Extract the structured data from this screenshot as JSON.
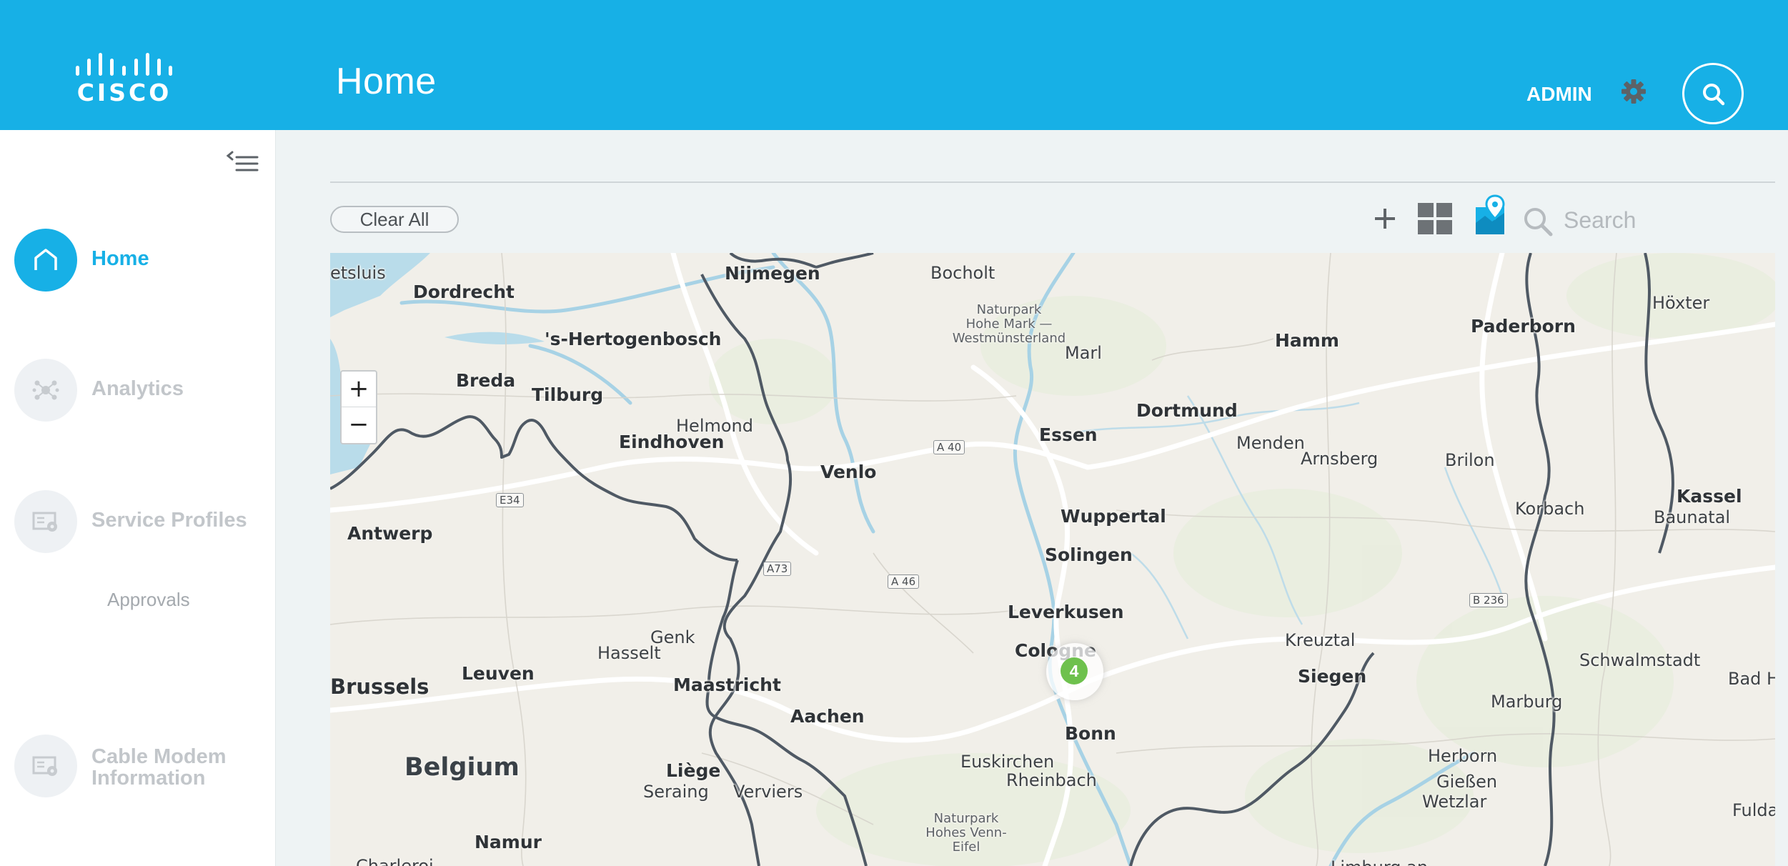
{
  "header": {
    "logo_text": "CISCO",
    "title": "Home",
    "user": "ADMIN",
    "settings_icon": "gear-icon",
    "search_icon": "search-icon",
    "color": "#17b0e6"
  },
  "sidebar": {
    "collapse_icon": "collapse-menu-icon",
    "items": [
      {
        "label": "Home",
        "icon": "home-icon",
        "active": true
      },
      {
        "label": "Analytics",
        "icon": "analytics-icon",
        "active": false
      },
      {
        "label": "Service Profiles",
        "icon": "service-profiles-icon",
        "active": false
      },
      {
        "label": "Cable Modem Information",
        "icon": "cable-modem-icon",
        "active": false
      }
    ],
    "sub_items": [
      {
        "label": "Approvals"
      }
    ]
  },
  "toolbar": {
    "clear_all": "Clear All",
    "add_icon": "plus-icon",
    "grid_icon": "grid-view-icon",
    "map_icon": "map-view-icon",
    "search_placeholder": "Search"
  },
  "map": {
    "zoom_in": "+",
    "zoom_out": "−",
    "cluster_count": "4",
    "cluster_color": "#6ec14d",
    "labels": {
      "etsluis": "etsluis",
      "nijmegen": "Nijmegen",
      "bocholt": "Bocholt",
      "hoxter": "Höxter",
      "dordrecht": "Dordrecht",
      "park1": "Naturpark\nHohe Mark —\nWestmünsterland",
      "hamm": "Hamm",
      "paderborn": "Paderborn",
      "hertogenbosch": "'s-Hertogenbosch",
      "marl": "Marl",
      "breda": "Breda",
      "tilburg": "Tilburg",
      "dortmund": "Dortmund",
      "helmond": "Helmond",
      "eindhoven": "Eindhoven",
      "essen": "Essen",
      "menden": "Menden",
      "arnsberg": "Arnsberg",
      "brilon": "Brilon",
      "venlo": "Venlo",
      "kassel": "Kassel",
      "baunatal": "Baunatal",
      "korbach": "Korbach",
      "wuppertal": "Wuppertal",
      "antwerp": "Antwerp",
      "solingen": "Solingen",
      "leverkusen": "Leverkusen",
      "genk": "Genk",
      "kreuztal": "Kreuztal",
      "hasselt": "Hasselt",
      "cologne": "Cologne",
      "schwalmstadt": "Schwalmstadt",
      "leuven": "Leuven",
      "siegen": "Siegen",
      "badhersfeld": "Bad Her",
      "brussels": "Brussels",
      "maastricht": "Maastricht",
      "marburg": "Marburg",
      "aachen": "Aachen",
      "bonn": "Bonn",
      "herborn": "Herborn",
      "belgium": "Belgium",
      "euskirchen": "Euskirchen",
      "liege": "Liège",
      "rheinbach": "Rheinbach",
      "giessen": "Gießen",
      "seraing": "Seraing",
      "verviers": "Verviers",
      "wetzlar": "Wetzlar",
      "fulda": "Fulda",
      "park2": "Naturpark\nHohes Venn-\nEifel",
      "namur": "Namur",
      "charleroi": "Charleroi",
      "limburg": "Limburg an"
    },
    "roads": {
      "a40": "A 40",
      "e34": "E34",
      "a73": "A73",
      "a46": "A 46",
      "b236": "B 236"
    }
  }
}
